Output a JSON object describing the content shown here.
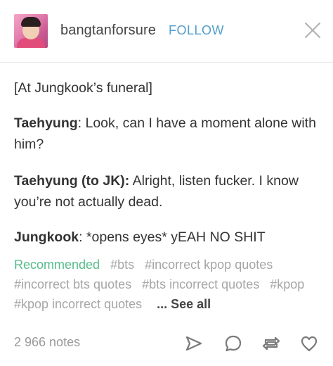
{
  "post": {
    "username": "bangtanforsure",
    "follow_label": "FOLLOW"
  },
  "body": {
    "line1": "[At Jungkook’s funeral]",
    "p2_speaker": "Taehyung",
    "p2_text": ": Look, can I have a moment alone with him?",
    "p3_speaker": "Taehyung (to JK):",
    "p3_text": " Alright, listen fucker. I know you’re not actually dead.",
    "p4_speaker": "Jungkook",
    "p4_text": ": *opens eyes* yEAH NO SHIT"
  },
  "tags": {
    "recommended": "Recommended",
    "items": [
      "#bts",
      "#incorrect kpop quotes",
      "#incorrect bts quotes",
      "#bts incorrect quotes",
      "#kpop",
      "#kpop incorrect quotes"
    ],
    "see_all": "... See all"
  },
  "footer": {
    "notes": "2 966 notes",
    "icons": [
      "share-icon",
      "reply-icon",
      "reblog-icon",
      "like-icon"
    ]
  },
  "colors": {
    "follow": "#529ecc",
    "recommended": "#56bc8a",
    "tag": "#a6a6a6",
    "text": "#333333"
  }
}
